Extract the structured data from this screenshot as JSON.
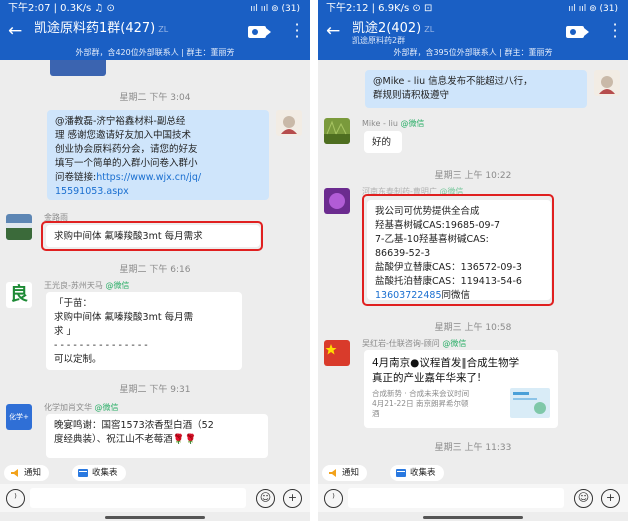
{
  "left": {
    "status": {
      "time": "下午2:07 | 0.3K/s ♫ ⊙",
      "right": "ııl ııl ⊚ (31)"
    },
    "title": "凯途原料药1群(427)",
    "title_tag": "ZL",
    "subtitle": "",
    "group_note": "外部群，含420位外部联系人 | 群主：董丽芳",
    "time1": "星期二 下午 3:04",
    "self_msg": [
      "@潘教磊-济宁裕鑫材料-副总经",
      "理  感谢您邀请好友加入中国技术",
      "创业协会原料药分会，请您的好友",
      "填写一个简单的入群小问卷入群小",
      "问卷链接:"
    ],
    "self_link1": "https://www.wjx.cn/jq/",
    "self_link2": "15591053.aspx",
    "sender1": "金路雨",
    "msg1": "求购中间体 氟嗪羧酸3mt 每月需求",
    "time2": "星期二 下午 6:16",
    "sender2_name": "王光良-苏州天马",
    "wx_tag": "@微信",
    "avatar2_char": "良",
    "msg2": [
      "「于苗：",
      "求购中间体 氟嗪羧酸3mt 每月需",
      "求 」",
      "- - - - - - - - - - - - - - -",
      "可以定制。"
    ],
    "time3": "星期二 下午 9:31",
    "sender3_name": "化学加肖文华",
    "avatar3_text": "化学+",
    "msg3": [
      "晚宴鸣谢：国窖1573浓香型白酒（52",
      "度经典装）、祝江山不老莓酒🌹🌹"
    ],
    "chip_notice": "通知",
    "chip_collect": "收集表"
  },
  "right": {
    "status": {
      "time": "下午2:12 | 6.9K/s ⊙ ⊡",
      "right": "ııl ııl ⊚ (31)"
    },
    "title": "凯途2(402)",
    "title_tag": "ZL",
    "subtitle": "凯途原料药2群",
    "group_note": "外部群，含395位外部联系人 | 群主：董丽芳",
    "self_msg": [
      "@Mike - liu  信息发布不能超过八行，",
      "群规则请积极遵守"
    ],
    "sender1_name": "Mike - liu",
    "wx_tag": "@微信",
    "msg1": "好的",
    "time1": "星期三 上午 10:22",
    "sender2_name": "河南东泰制药-曹明广",
    "msg2": [
      "我公司可优势提供全合成",
      "羟基喜树碱CAS:19685-09-7",
      "7-乙基-10羟基喜树碱CAS:",
      "86639-52-3",
      "盐酸伊立替康CAS：136572-09-3",
      "盐酸托泊替康CAS：119413-54-6"
    ],
    "msg2_phone": "13603722485",
    "msg2_tail": "同微信",
    "time2": "星期三 上午 10:58",
    "sender3_name": "吴红岩-仕联咨询-顾问",
    "card_title": [
      "4月南京●议程首发‖合成生物学",
      "真正的产业嘉年华来了!"
    ],
    "card_desc": [
      "合成新势 · 合成未来会议时间",
      "4月21-22日 南京朗昇希尔顿",
      "酒"
    ],
    "time3": "星期三 上午 11:33",
    "chip_notice": "通知",
    "chip_collect": "收集表"
  },
  "colors": {
    "header": "#1a5fc4",
    "self_bubble": "#cfe5fb",
    "wechat_tag": "#2aae67",
    "link": "#1a6fd0",
    "highlight": "#e02020"
  }
}
